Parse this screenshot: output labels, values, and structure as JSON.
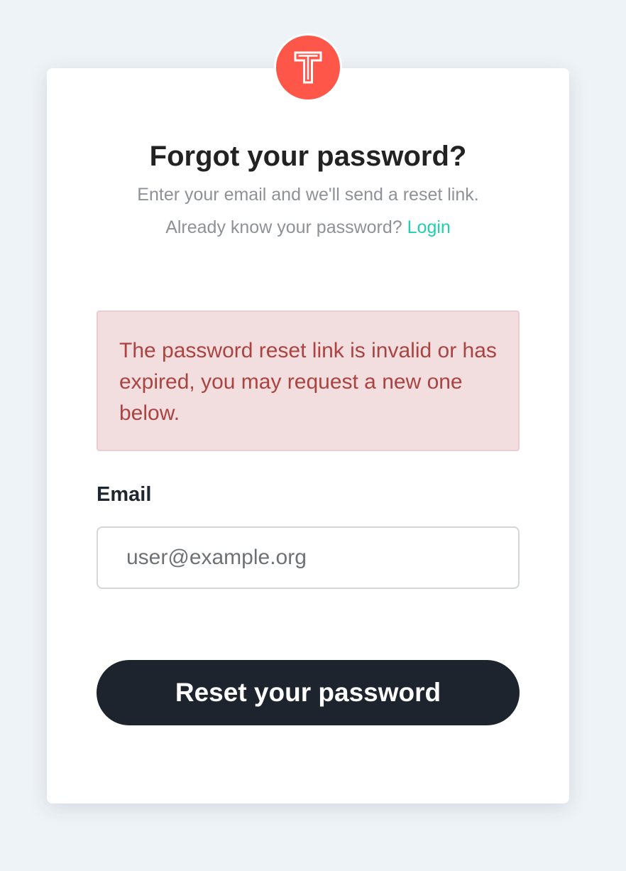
{
  "brand": {
    "logo_icon": "t-letter-logo-icon",
    "logo_color": "#fe5649"
  },
  "header": {
    "title": "Forgot your password?",
    "subtitle": "Enter your email and we'll send a reset link.",
    "login_prompt": "Already know your password?",
    "login_link": "Login"
  },
  "alert": {
    "message": "The password reset link is invalid or has expired, you may request a new one below."
  },
  "form": {
    "email_label": "Email",
    "email_value": "",
    "email_placeholder": "user@example.org",
    "submit_label": "Reset your password"
  },
  "colors": {
    "accent": "#1fcfb0",
    "button": "#1d242d",
    "alert_text": "#a94442",
    "alert_background": "#f2dede"
  }
}
